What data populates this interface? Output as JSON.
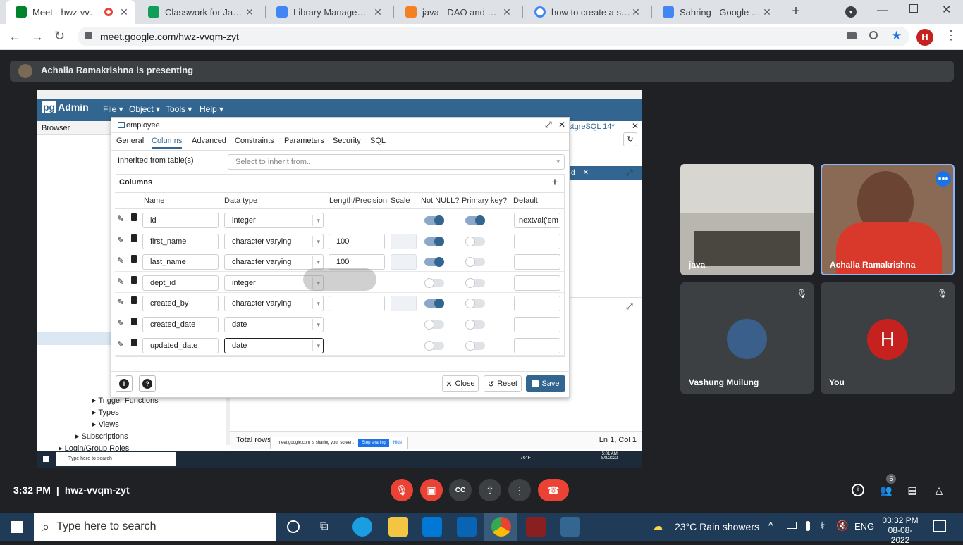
{
  "browser": {
    "tabs": [
      {
        "label": "Meet - hwz-vvqm",
        "color": "#00832d"
      },
      {
        "label": "Classwork for Java Trai",
        "color": "#0f9d58"
      },
      {
        "label": "Library Management S",
        "color": "#4285f4"
      },
      {
        "label": "java - DAO and Service",
        "color": "#f48024"
      },
      {
        "label": "how to create a service",
        "color": "#4285f4"
      },
      {
        "label": "Sahring - Google Docs",
        "color": "#4285f4"
      }
    ],
    "url": "meet.google.com/hwz-vvqm-zyt",
    "profile_initial": "H"
  },
  "meet": {
    "presenting_text": "Achalla Ramakrishna is presenting",
    "time": "3:32 PM",
    "separator": "|",
    "meeting_code": "hwz-vvqm-zyt",
    "participant_count": "5",
    "tiles": [
      {
        "name": "java"
      },
      {
        "name": "Achalla Ramakrishna"
      },
      {
        "name": "Vashung Muilung"
      },
      {
        "name": "You",
        "initial": "H"
      }
    ]
  },
  "pgadmin": {
    "logo_pg": "pg",
    "logo_admin": "Admin",
    "menus": [
      "File ▾",
      "Object ▾",
      "Tools ▾",
      "Help ▾"
    ],
    "browser_label": "Browser",
    "tree_items": [
      "Trigger Functions",
      "Types",
      "Views",
      "Subscriptions",
      "Login/Group Roles"
    ],
    "right_tab": "stgreSQL 14*",
    "status_left": "Total rows",
    "status_right": "Ln 1, Col 1",
    "sharing_bar": {
      "text": "meet.google.com is sharing your screen.",
      "stop": "Stop sharing",
      "hide": "Hide"
    },
    "inner_taskbar": {
      "search": "Type here to search",
      "weather": "76°F",
      "clock_time": "5:01 AM",
      "clock_date": "8/8/2022"
    }
  },
  "dialog": {
    "title": "employee",
    "tabs": [
      "General",
      "Columns",
      "Advanced",
      "Constraints",
      "Parameters",
      "Security",
      "SQL"
    ],
    "active_tab": "Columns",
    "inherit_label": "Inherited from table(s)",
    "inherit_placeholder": "Select to inherit from...",
    "columns_section": "Columns",
    "headers": [
      "Name",
      "Data type",
      "Length/Precision",
      "Scale",
      "Not NULL?",
      "Primary key?",
      "Default"
    ],
    "rows": [
      {
        "name": "id",
        "type": "integer",
        "length": "",
        "not_null": true,
        "pk": true,
        "default": "nextval('em"
      },
      {
        "name": "first_name",
        "type": "character varying",
        "length": "100",
        "not_null": true,
        "pk": false,
        "default": ""
      },
      {
        "name": "last_name",
        "type": "character varying",
        "length": "100",
        "not_null": true,
        "pk": false,
        "default": ""
      },
      {
        "name": "dept_id",
        "type": "integer",
        "length": "",
        "not_null": false,
        "pk": false,
        "default": ""
      },
      {
        "name": "created_by",
        "type": "character varying",
        "length": "",
        "not_null": true,
        "pk": false,
        "default": ""
      },
      {
        "name": "created_date",
        "type": "date",
        "length": "",
        "not_null": false,
        "pk": false,
        "default": ""
      },
      {
        "name": "updated_date",
        "type": "date",
        "length": "",
        "not_null": false,
        "pk": false,
        "default": ""
      }
    ],
    "buttons": {
      "close": "Close",
      "reset": "Reset",
      "save": "Save"
    }
  },
  "taskbar": {
    "search_placeholder": "Type here to search",
    "weather": "23°C  Rain showers",
    "lang": "ENG",
    "time": "03:32 PM",
    "date": "08-08-2022"
  },
  "colors": {
    "pg_blue": "#326690",
    "meet_red": "#ea4335",
    "accent_blue": "#1a73e8"
  }
}
